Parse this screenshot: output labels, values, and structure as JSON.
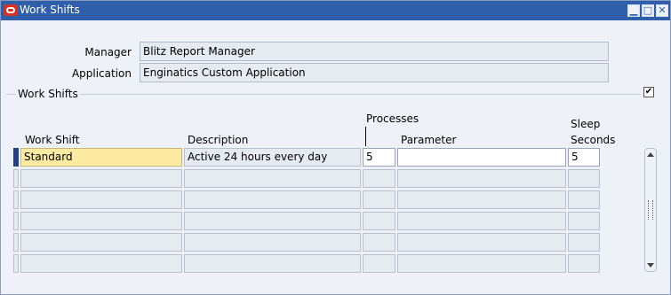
{
  "window": {
    "title": "Work Shifts",
    "minimize_label": "▁",
    "maximize_label": "□",
    "close_label": "✕"
  },
  "header": {
    "manager_label": "Manager",
    "manager_value": "Blitz Report Manager",
    "application_label": "Application",
    "application_value": "Enginatics Custom Application"
  },
  "section": {
    "title": "Work Shifts",
    "checkbox_checked": true,
    "checkbox_mark": "✔"
  },
  "table": {
    "headers": {
      "work_shift": "Work Shift",
      "description": "Description",
      "processes": "Processes",
      "parameter": "Parameter",
      "sleep": "Sleep",
      "seconds": "Seconds"
    },
    "rows": [
      {
        "work_shift": "Standard",
        "description": "Active 24 hours every day",
        "processes": "5",
        "parameter": "",
        "sleep_seconds": "5"
      },
      {
        "work_shift": "",
        "description": "",
        "processes": "",
        "parameter": "",
        "sleep_seconds": ""
      },
      {
        "work_shift": "",
        "description": "",
        "processes": "",
        "parameter": "",
        "sleep_seconds": ""
      },
      {
        "work_shift": "",
        "description": "",
        "processes": "",
        "parameter": "",
        "sleep_seconds": ""
      },
      {
        "work_shift": "",
        "description": "",
        "processes": "",
        "parameter": "",
        "sleep_seconds": ""
      },
      {
        "work_shift": "",
        "description": "",
        "processes": "",
        "parameter": "",
        "sleep_seconds": ""
      }
    ]
  },
  "colors": {
    "title_bar": "#2f5faa",
    "current_cell": "#fdeba2",
    "row_indicator_active": "#243f84"
  }
}
